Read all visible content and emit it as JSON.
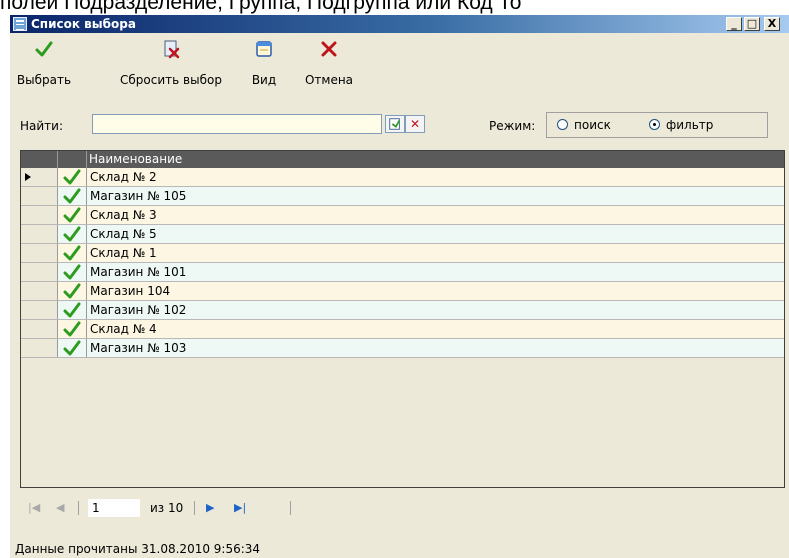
{
  "background_text": "полей Подразделение, Группа, Подгруппа или Код То",
  "window": {
    "title": "Список выбора",
    "controls": {
      "minimize": "_",
      "maximize": "□",
      "close": "X"
    }
  },
  "toolbar": {
    "select": "Выбрать",
    "reset": "Сбросить выбор",
    "view": "Вид",
    "cancel": "Отмена"
  },
  "search": {
    "label": "Найти:",
    "value": "",
    "mode_label": "Режим:",
    "modes": [
      {
        "label": "поиск",
        "selected": false
      },
      {
        "label": "фильтр",
        "selected": true
      }
    ]
  },
  "grid": {
    "header": "Наименование",
    "current_row_index": 0,
    "rows": [
      {
        "name": "Склад № 2",
        "checked": true
      },
      {
        "name": "Магазин № 105",
        "checked": true
      },
      {
        "name": "Склад № 3",
        "checked": true
      },
      {
        "name": "Склад № 5",
        "checked": true
      },
      {
        "name": "Склад № 1",
        "checked": true
      },
      {
        "name": "Магазин № 101",
        "checked": true
      },
      {
        "name": "Магазин 104",
        "checked": true
      },
      {
        "name": "Магазин № 102",
        "checked": true
      },
      {
        "name": "Склад № 4",
        "checked": true
      },
      {
        "name": "Магазин № 103",
        "checked": true
      }
    ]
  },
  "navigator": {
    "page_value": "1",
    "page_of": "из 10"
  },
  "status": "Данные прочитаны 31.08.2010 9:56:34",
  "colors": {
    "row_odd": "#fdf6e3",
    "row_even": "#eef9f6",
    "check": "#2c9c1e",
    "cancel_x": "#c0141c",
    "nav_active": "#1e64c8",
    "nav_disabled": "#a8a8a8"
  }
}
